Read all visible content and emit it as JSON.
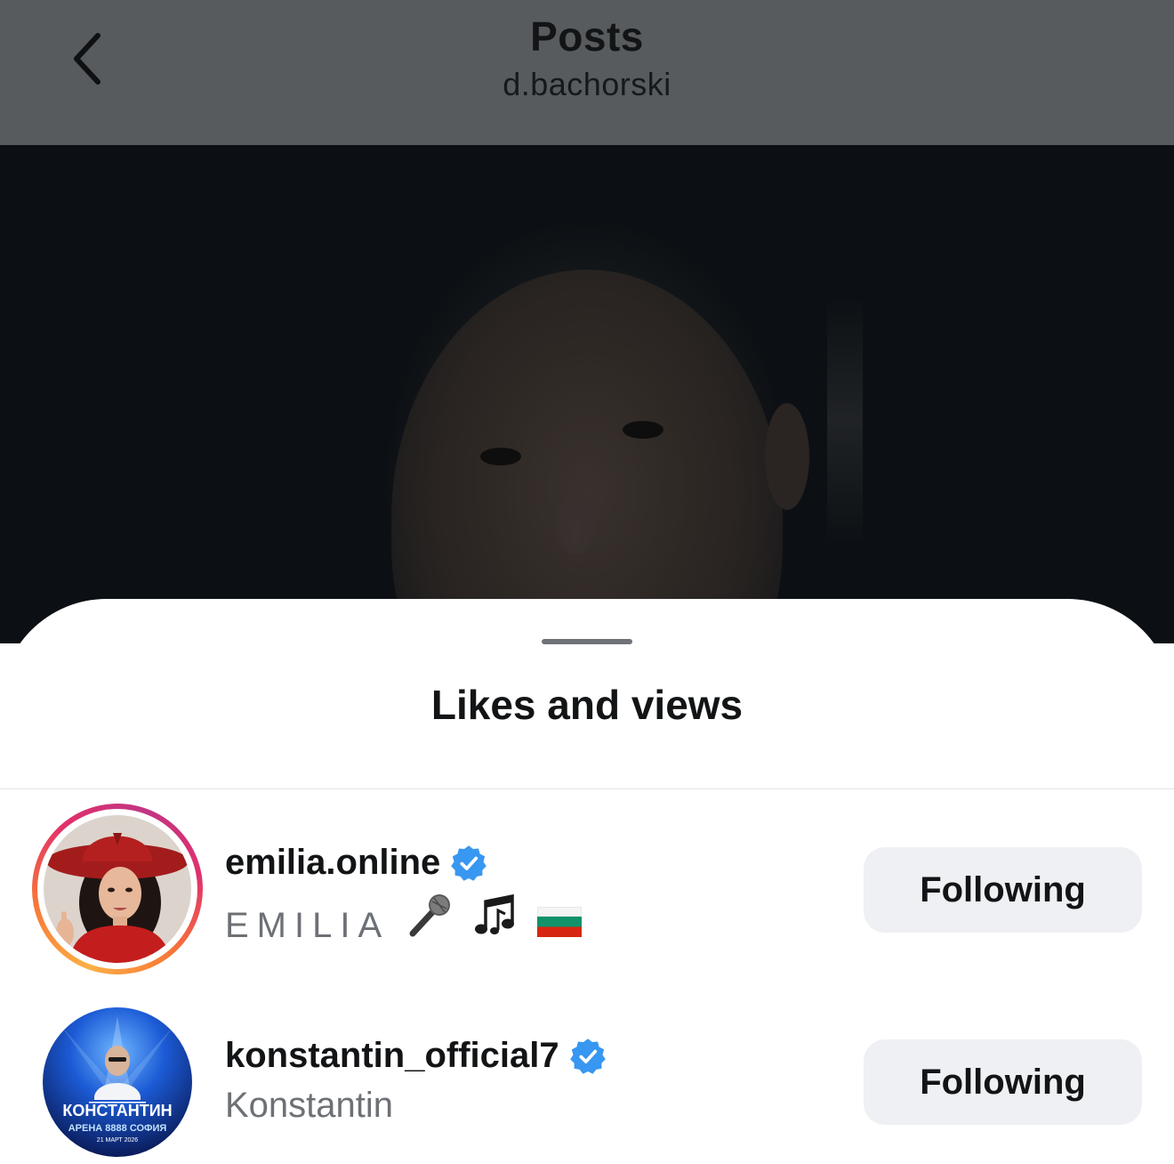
{
  "header": {
    "title": "Posts",
    "subtitle": "d.bachorski"
  },
  "sheet": {
    "title": "Likes and views"
  },
  "users": [
    {
      "username": "emilia.online",
      "display_name": "EMILIA",
      "verified": true,
      "has_story_ring": true,
      "emojis": [
        "microphone-icon",
        "music-notes-icon",
        "bulgaria-flag-icon"
      ],
      "button_label": "Following"
    },
    {
      "username": "konstantin_official7",
      "display_name": "Konstantin",
      "verified": true,
      "has_story_ring": false,
      "button_label": "Following",
      "avatar_text": {
        "name": "КОНСТАНТИН",
        "venue": "АРЕНА 8888 СОФИЯ",
        "date": "21 МАРТ 2026"
      }
    }
  ],
  "colors": {
    "header_bg": "#575b5e",
    "verified_blue": "#3897f0",
    "button_bg": "#eff0f3",
    "secondary_text": "#6d7176"
  }
}
